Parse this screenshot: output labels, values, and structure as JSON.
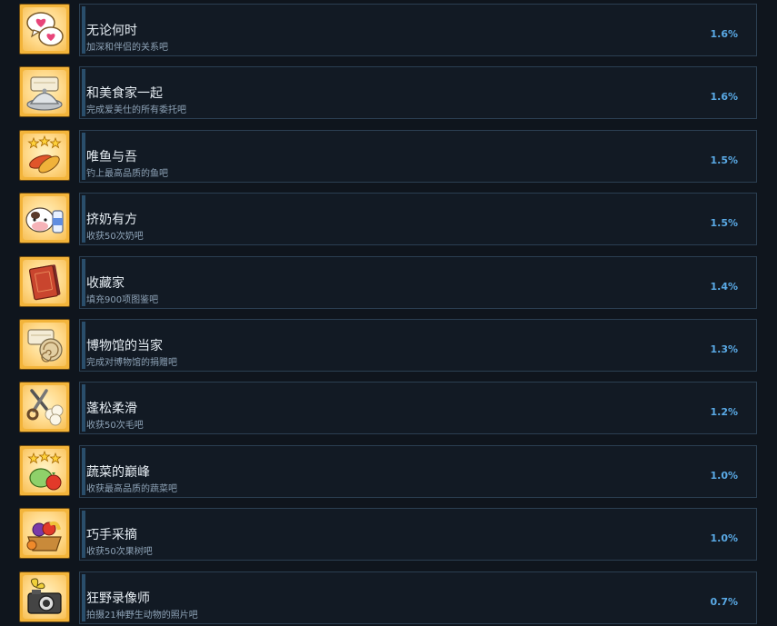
{
  "achievements": [
    {
      "title": "无论何时",
      "desc": "加深和伴侣的关系吧",
      "percent": "1.6%",
      "icon": "hearts-speech-bubbles-icon"
    },
    {
      "title": "和美食家一起",
      "desc": "完成爱美仕的所有委托吧",
      "percent": "1.6%",
      "icon": "cloche-dish-icon"
    },
    {
      "title": "唯鱼与吾",
      "desc": "钓上最高品质的鱼吧",
      "percent": "1.5%",
      "icon": "golden-fish-stars-icon"
    },
    {
      "title": "挤奶有方",
      "desc": "收获50次奶吧",
      "percent": "1.5%",
      "icon": "cow-milk-bottle-icon"
    },
    {
      "title": "收藏家",
      "desc": "填充900项图鉴吧",
      "percent": "1.4%",
      "icon": "book-icon"
    },
    {
      "title": "博物馆的当家",
      "desc": "完成对博物馆的捐赠吧",
      "percent": "1.3%",
      "icon": "museum-fossil-icon"
    },
    {
      "title": "蓬松柔滑",
      "desc": "收获50次毛吧",
      "percent": "1.2%",
      "icon": "shears-wool-icon"
    },
    {
      "title": "蔬菜的巅峰",
      "desc": "收获最高品质的蔬菜吧",
      "percent": "1.0%",
      "icon": "vegetables-stars-icon"
    },
    {
      "title": "巧手采摘",
      "desc": "收获50次果树吧",
      "percent": "1.0%",
      "icon": "fruit-basket-icon"
    },
    {
      "title": "狂野录像师",
      "desc": "拍摄21种野生动物的照片吧",
      "percent": "0.7%",
      "icon": "camera-butterfly-icon"
    }
  ],
  "colors": {
    "background": "#0f151d",
    "card_border": "#2b3f52",
    "percent_text": "#5aaae6",
    "icon_frame": "#f3b43a"
  }
}
